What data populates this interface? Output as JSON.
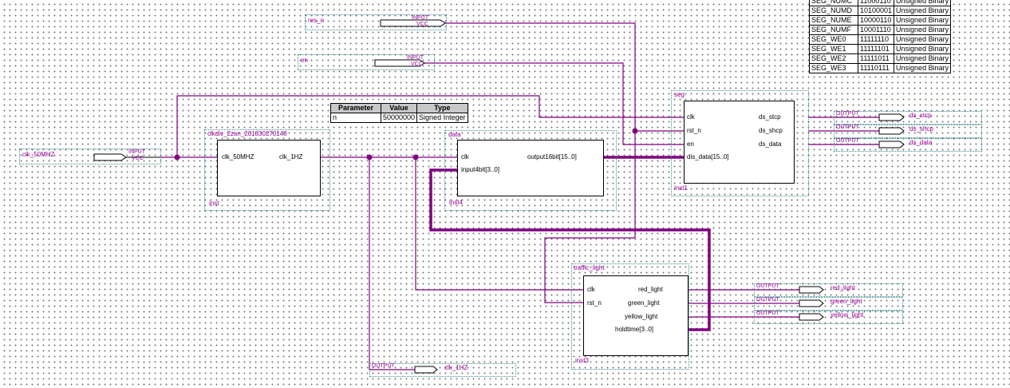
{
  "inputs": {
    "res_n": {
      "name": "res_n",
      "tag": "INPUT",
      "sub": "VCC"
    },
    "en": {
      "name": "en",
      "tag": "INPUT",
      "sub": "VCC"
    },
    "clk": {
      "name": "clk_50MHZ",
      "tag": "INPUT",
      "sub": "VCC"
    }
  },
  "outputs": {
    "ds_stcp": {
      "tag": "OUTPUT",
      "name": "ds_stcp"
    },
    "ds_shcp": {
      "tag": "OUTPUT",
      "name": "ds_shcp"
    },
    "ds_data": {
      "tag": "OUTPUT",
      "name": "ds_data"
    },
    "red_light": {
      "tag": "OUTPUT",
      "name": "red_light"
    },
    "green_light": {
      "tag": "OUTPUT",
      "name": "green_light"
    },
    "yellow_light": {
      "tag": "OUTPUT",
      "name": "yellow_light"
    },
    "clk_1hz": {
      "tag": "OUTPUT",
      "name": "clk_1HZ"
    }
  },
  "clkdiv": {
    "title": "clkdiv_2zan_201830270148",
    "port_in": "clk_50MHZ",
    "port_out": "clk_1HZ",
    "inst": "inst"
  },
  "data": {
    "title": "data",
    "port_clk": "clk",
    "port_in": "input4bit[3..0]",
    "port_out": "output16bit[15..0]",
    "inst": "inst4"
  },
  "seg": {
    "title": "seg",
    "p_clk": "clk",
    "p_rst": "rst_n",
    "p_en": "en",
    "p_dis": "dis_data[15..0]",
    "o1": "ds_stcp",
    "o2": "ds_shcp",
    "o3": "ds_data",
    "inst": "inst1"
  },
  "traffic": {
    "title": "traffic_light",
    "p_clk": "clk",
    "p_rst": "rst_n",
    "o1": "red_light",
    "o2": "green_light",
    "o3": "yellow_light",
    "o4": "holdtime[3..0]",
    "inst": "inst3"
  },
  "param_table": {
    "headers": [
      "Parameter",
      "Value",
      "Type"
    ],
    "rows": [
      [
        "n",
        "50000000",
        "Signed Integer"
      ]
    ]
  },
  "seg_table": {
    "rows": [
      [
        "SEG_NUMC",
        "11000110",
        "Unsigned Binary"
      ],
      [
        "SEG_NUMD",
        "10100001",
        "Unsigned Binary"
      ],
      [
        "SEG_NUME",
        "10000110",
        "Unsigned Binary"
      ],
      [
        "SEG_NUMF",
        "10001110",
        "Unsigned Binary"
      ],
      [
        "SEG_WE0",
        "11111110",
        "Unsigned Binary"
      ],
      [
        "SEG_WE1",
        "11111101",
        "Unsigned Binary"
      ],
      [
        "SEG_WE2",
        "11111011",
        "Unsigned Binary"
      ],
      [
        "SEG_WE3",
        "11110111",
        "Unsigned Binary"
      ]
    ]
  },
  "colors": {
    "wire": "#800080",
    "bus": "#800080",
    "frame": "#3a8b8b",
    "text": "#990099"
  }
}
